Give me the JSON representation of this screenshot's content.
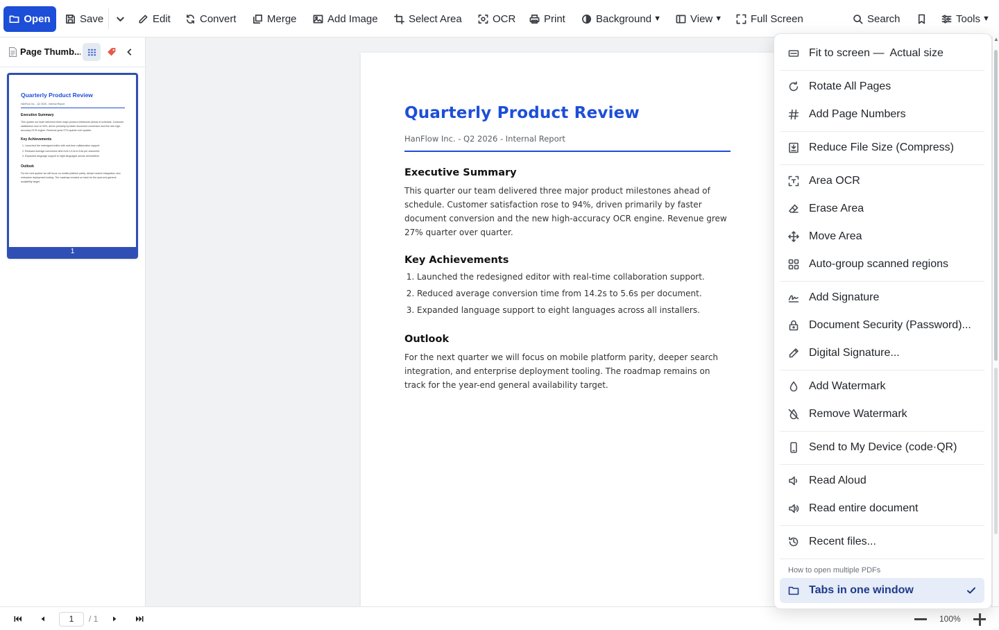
{
  "toolbar": {
    "open": "Open",
    "save": "Save",
    "edit": "Edit",
    "convert": "Convert",
    "merge": "Merge",
    "add_image": "Add Image",
    "select_area": "Select Area",
    "ocr": "OCR",
    "print": "Print",
    "background": "Background",
    "view": "View",
    "full_screen": "Full Screen",
    "search": "Search",
    "tools": "Tools"
  },
  "sidebar": {
    "title": "Page Thumb...",
    "page_number": "1"
  },
  "document": {
    "title": "Quarterly Product Review",
    "subtitle": "HanFlow Inc. - Q2 2026 - Internal Report",
    "sections": [
      {
        "heading": "Executive Summary",
        "body": "This quarter our team delivered three major product milestones ahead of schedule. Customer satisfaction rose to 94%, driven primarily by faster document conversion and the new high-accuracy OCR engine. Revenue grew 27% quarter over quarter."
      },
      {
        "heading": "Key Achievements",
        "items": [
          "Launched the redesigned editor with real-time collaboration support.",
          "Reduced average conversion time from 14.2s to 5.6s per document.",
          "Expanded language support to eight languages across all installers."
        ]
      },
      {
        "heading": "Outlook",
        "body": "For the next quarter we will focus on mobile platform parity, deeper search integration, and enterprise deployment tooling. The roadmap remains on track for the year-end general availability target."
      }
    ]
  },
  "status": {
    "current_page": "1",
    "total_pages": "/ 1",
    "zoom": "100%"
  },
  "tools_menu": {
    "fit_to_screen": "Fit to screen",
    "actual_size": "Actual size",
    "rotate_all_pages": "Rotate All Pages",
    "add_page_numbers": "Add Page Numbers",
    "reduce_file_size": "Reduce File Size (Compress)",
    "area_ocr": "Area OCR",
    "erase_area": "Erase Area",
    "move_area": "Move Area",
    "auto_group": "Auto-group scanned regions",
    "add_signature": "Add Signature",
    "document_security": "Document Security (Password)...",
    "digital_signature": "Digital Signature...",
    "add_watermark": "Add Watermark",
    "remove_watermark": "Remove Watermark",
    "send_to_device": "Send to My Device (code·QR)",
    "read_aloud": "Read Aloud",
    "read_entire": "Read entire document",
    "recent_files": "Recent files...",
    "multi_pdf_heading": "How to open multiple PDFs",
    "tabs_in_one_window": "Tabs in one window"
  },
  "colors": {
    "accent": "#1d4ed8",
    "thumb_border": "#2f4fb5",
    "selected_bg": "#e6ecf8"
  }
}
